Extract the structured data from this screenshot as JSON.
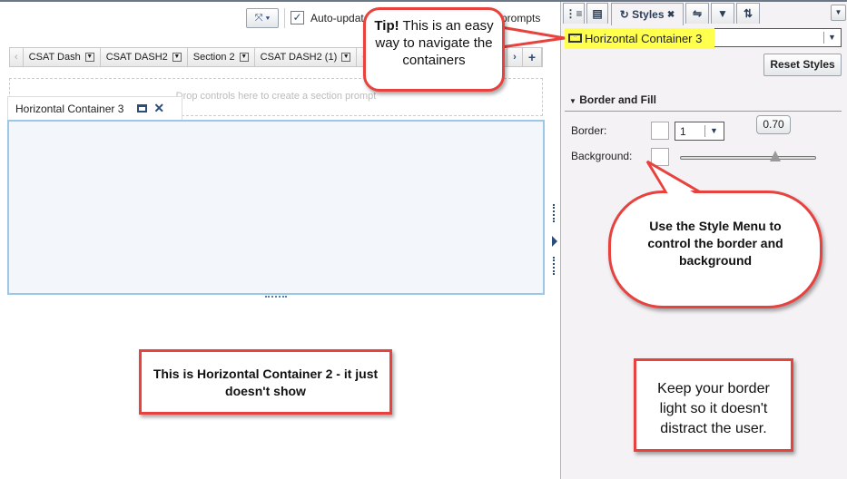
{
  "toolbar": {
    "auto_update_label": "Auto-update",
    "prompts_label": "prompts",
    "auto_update_checked": true
  },
  "section_tabs": [
    {
      "label": "CSAT Dash"
    },
    {
      "label": "CSAT DASH2"
    },
    {
      "label": "Section 2"
    },
    {
      "label": "CSAT DASH2 (1)"
    },
    {
      "label": "CS"
    }
  ],
  "drop_zone": "Drop controls here to create a section prompt",
  "container": {
    "title": "Horizontal Container 3"
  },
  "panel": {
    "active_tab": "Styles",
    "object_select": "Horizontal Container 3",
    "reset_label": "Reset Styles",
    "section_title": "Border and Fill",
    "border_label": "Border:",
    "border_width": "1",
    "background_label": "Background:",
    "transparency_value": "0.70",
    "transparency_fraction": 0.7
  },
  "callouts": {
    "tip_bold": "Tip!",
    "tip_text": " This is an easy way to navigate the containers",
    "style_menu": "Use the Style Menu to control the border and background",
    "container2": "This is Horizontal Container 2 - it just doesn't show",
    "border_light": "Keep your border light so it doesn't distract the user."
  },
  "colors": {
    "callout_border": "#e8423f",
    "highlight": "#ffff4d",
    "container_border": "#9cc7e6"
  }
}
